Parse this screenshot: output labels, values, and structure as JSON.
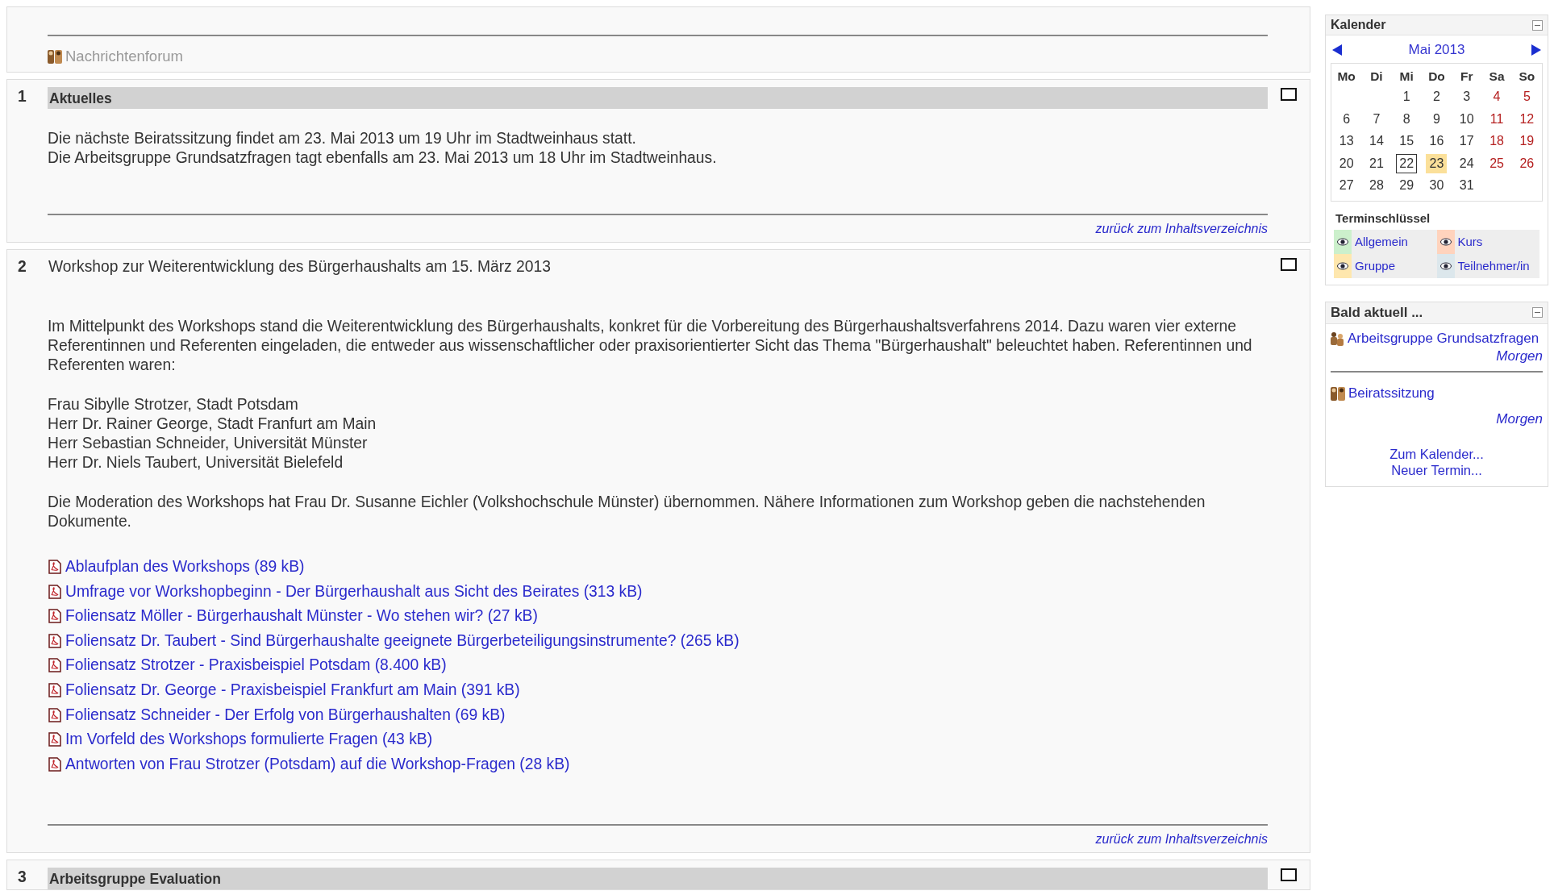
{
  "top_section": {
    "items": [
      {
        "label": "Nachrichtenforum",
        "kind": "forum",
        "dimmed": true
      }
    ]
  },
  "sections": [
    {
      "number": "1",
      "title": "Aktuelles",
      "kind": "bar",
      "blocks": [
        {
          "kind": "lines",
          "lines": [
            "Die nächste Beiratssitzung findet am 23. Mai 2013 um 19 Uhr im Stadtweinhaus statt.",
            "Die Arbeitsgruppe Grundsatzfragen tagt ebenfalls am 23. Mai 2013 um 18 Uhr im Stadtweinhaus."
          ]
        }
      ],
      "back_link": "zurück zum Inhaltsverzeichnis"
    },
    {
      "number": "2",
      "title": "Workshop zur Weiterentwicklung des Bürgerhaushalts am 15. März 2013",
      "kind": "plain",
      "blocks": [
        {
          "kind": "paragraph",
          "text": "Im Mittelpunkt des Workshops stand die Weiterentwicklung des Bürgerhaushalts, konkret für die Vorbereitung des Bürgerhaushaltsverfahrens 2014. Dazu waren vier externe Referentinnen und Referenten eingeladen, die entweder aus wissenschaftlicher oder praxisorientierter Sicht das Thema \"Bürgerhaushalt\" beleuchtet haben. Referentinnen und Referenten waren:"
        },
        {
          "kind": "lines",
          "lines": [
            "Frau Sibylle Strotzer, Stadt Potsdam",
            "Herr Dr. Rainer George, Stadt Franfurt am Main",
            "Herr Sebastian Schneider, Universität Münster",
            "Herr Dr. Niels Taubert, Universität Bielefeld"
          ]
        },
        {
          "kind": "paragraph",
          "text": "Die Moderation des Workshops hat Frau Dr. Susanne Eichler (Volkshochschule Münster) übernommen. Nähere Informationen zum Workshop geben die nachstehenden Dokumente."
        },
        {
          "kind": "files",
          "items": [
            "Ablaufplan des Workshops (89 kB)",
            "Umfrage vor Workshopbeginn - Der Bürgerhaushalt aus Sicht des Beirates (313 kB)",
            "Foliensatz Möller - Bürgerhaushalt Münster - Wo stehen wir? (27 kB)",
            "Foliensatz Dr. Taubert - Sind Bürgerhaushalte geeignete Bürgerbeteiligungsinstrumente? (265 kB)",
            "Foliensatz Strotzer - Praxisbeispiel Potsdam (8.400 kB)",
            "Foliensatz Dr. George - Praxisbeispiel Frankfurt am Main (391 kB)",
            "Foliensatz Schneider - Der Erfolg von Bürgerhaushalten (69 kB)",
            "Im Vorfeld des Workshops formulierte Fragen (43 kB)",
            "Antworten von Frau Strotzer (Potsdam) auf die Workshop-Fragen (28 kB)"
          ]
        }
      ],
      "back_link": "zurück zum Inhaltsverzeichnis"
    },
    {
      "number": "3",
      "title": "Arbeitsgruppe Evaluation",
      "kind": "bar"
    }
  ],
  "calendar": {
    "title": "Kalender",
    "month": "Mai 2013",
    "weekdays": [
      "Mo",
      "Di",
      "Mi",
      "Do",
      "Fr",
      "Sa",
      "So"
    ],
    "weeks": [
      {
        "starts_mid_week": true,
        "days": [
          {
            "day": "1",
            "weekend": false,
            "today": false,
            "event": false
          },
          {
            "day": "2",
            "weekend": false,
            "today": false,
            "event": false
          },
          {
            "day": "3",
            "weekend": false,
            "today": false,
            "event": false
          },
          {
            "day": "4",
            "weekend": true,
            "today": false,
            "event": false
          },
          {
            "day": "5",
            "weekend": true,
            "today": false,
            "event": false
          }
        ]
      },
      {
        "days": [
          {
            "day": "6",
            "weekend": false,
            "today": false,
            "event": false
          },
          {
            "day": "7",
            "weekend": false,
            "today": false,
            "event": false
          },
          {
            "day": "8",
            "weekend": false,
            "today": false,
            "event": false
          },
          {
            "day": "9",
            "weekend": false,
            "today": false,
            "event": false
          },
          {
            "day": "10",
            "weekend": false,
            "today": false,
            "event": false
          },
          {
            "day": "11",
            "weekend": true,
            "today": false,
            "event": false
          },
          {
            "day": "12",
            "weekend": true,
            "today": false,
            "event": false
          }
        ]
      },
      {
        "days": [
          {
            "day": "13",
            "weekend": false,
            "today": false,
            "event": false
          },
          {
            "day": "14",
            "weekend": false,
            "today": false,
            "event": false
          },
          {
            "day": "15",
            "weekend": false,
            "today": false,
            "event": false
          },
          {
            "day": "16",
            "weekend": false,
            "today": false,
            "event": false
          },
          {
            "day": "17",
            "weekend": false,
            "today": false,
            "event": false
          },
          {
            "day": "18",
            "weekend": true,
            "today": false,
            "event": false
          },
          {
            "day": "19",
            "weekend": true,
            "today": false,
            "event": false
          }
        ]
      },
      {
        "days": [
          {
            "day": "20",
            "weekend": false,
            "today": false,
            "event": false
          },
          {
            "day": "21",
            "weekend": false,
            "today": false,
            "event": false
          },
          {
            "day": "22",
            "weekend": false,
            "today": true,
            "event": false
          },
          {
            "day": "23",
            "weekend": false,
            "today": false,
            "event": true
          },
          {
            "day": "24",
            "weekend": false,
            "today": false,
            "event": false
          },
          {
            "day": "25",
            "weekend": true,
            "today": false,
            "event": false
          },
          {
            "day": "26",
            "weekend": true,
            "today": false,
            "event": false
          }
        ]
      },
      {
        "days": [
          {
            "day": "27",
            "weekend": false,
            "today": false,
            "event": false
          },
          {
            "day": "28",
            "weekend": false,
            "today": false,
            "event": false
          },
          {
            "day": "29",
            "weekend": false,
            "today": false,
            "event": false
          },
          {
            "day": "30",
            "weekend": false,
            "today": false,
            "event": false
          },
          {
            "day": "31",
            "weekend": false,
            "today": false,
            "event": false
          }
        ]
      }
    ],
    "legend_title": "Terminschlüssel",
    "legend": [
      {
        "label": "Allgemein",
        "color": "#ccf0cc"
      },
      {
        "label": "Kurs",
        "color": "#ffd3bd"
      },
      {
        "label": "Gruppe",
        "color": "#fee7ae"
      },
      {
        "label": "Teilnehmer/in",
        "color": "#dce7ec"
      }
    ]
  },
  "upcoming": {
    "title": "Bald aktuell ...",
    "events": [
      {
        "title": "Arbeitsgruppe Grundsatzfragen",
        "when": "Morgen",
        "kind": "group"
      },
      {
        "title": "Beiratssitzung",
        "when": "Morgen",
        "kind": "course"
      }
    ],
    "links": [
      "Zum Kalender...",
      "Neuer Termin..."
    ]
  }
}
